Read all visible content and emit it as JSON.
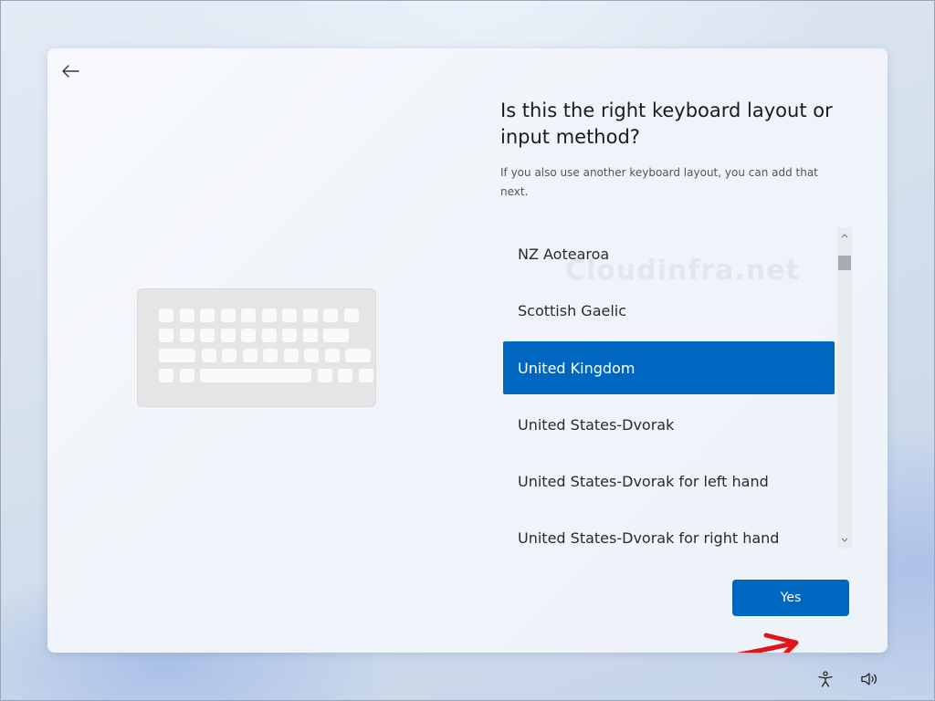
{
  "page": {
    "heading": "Is this the right keyboard layout or input method?",
    "subtext": "If you also use another keyboard layout, you can add that next."
  },
  "watermark": "Cloudinfra.net",
  "keyboard_layouts": {
    "items": [
      {
        "label": "NZ Aotearoa",
        "selected": false
      },
      {
        "label": "Scottish Gaelic",
        "selected": false
      },
      {
        "label": "United Kingdom",
        "selected": true
      },
      {
        "label": "United States-Dvorak",
        "selected": false
      },
      {
        "label": "United States-Dvorak for left hand",
        "selected": false
      },
      {
        "label": "United States-Dvorak for right hand",
        "selected": false
      }
    ]
  },
  "buttons": {
    "yes_label": "Yes"
  },
  "icons": {
    "back": "back-arrow-icon",
    "keyboard": "keyboard-illustration",
    "accessibility": "accessibility-icon",
    "volume": "volume-icon",
    "scroll_up": "chevron-up-icon",
    "scroll_down": "chevron-down-icon"
  },
  "colors": {
    "accent": "#0067c0",
    "annotation_arrow": "#e0151b"
  }
}
